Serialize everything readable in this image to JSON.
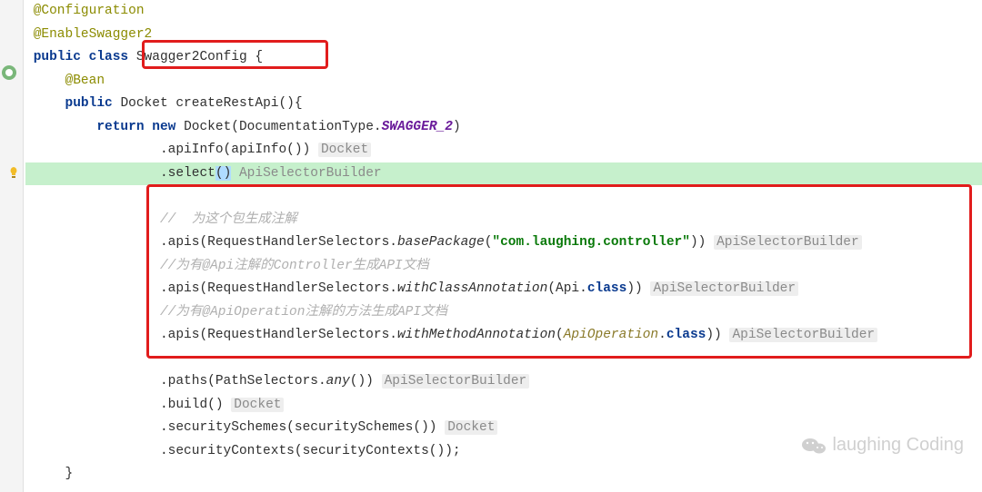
{
  "code": {
    "ann_configuration": "@Configuration",
    "ann_enable_swagger": "@EnableSwagger2",
    "kw_public": "public",
    "kw_class": "class",
    "class_name": " Swagger2Config ",
    "brace_open": "{",
    "brace_close": "}",
    "ann_bean": "@Bean",
    "return_type": "Docket",
    "method_name": "createRestApi",
    "parens": "()",
    "kw_return": "return",
    "kw_new": "new",
    "docket_ctor": "Docket(DocumentationType.",
    "swagger2_const": "SWAGGER_2",
    "close_paren": ")",
    "apiinfo_call": ".apiInfo(apiInfo()) ",
    "select_call": ".select",
    "select_paren_open": "(",
    "select_paren_close": ")",
    "hint_docket": "Docket",
    "hint_asb": "ApiSelectorBuilder",
    "comment_1": "//  为这个包生成注解",
    "apis_prefix": ".apis(RequestHandlerSelectors.",
    "basePackage": "basePackage",
    "pkg_str": "\"com.laughing.controller\"",
    "close2": ")) ",
    "comment_2": "//为有@Api注解的Controller生成API文档",
    "withClassAnnotation": "withClassAnnotation",
    "api_class_open": "(Api.",
    "kw_class_ref": "class",
    "comment_3": "//为有@ApiOperation注解的方法生成API文档",
    "withMethodAnnotation": "withMethodAnnotation",
    "apiop_open": "(",
    "ApiOperation": "ApiOperation",
    "dot_class_close": ".",
    "paths_line": ".paths(PathSelectors.",
    "any_ital": "any",
    "paths_end": "()) ",
    "build_line": ".build() ",
    "secSchemes": ".securitySchemes(securitySchemes()) ",
    "secContexts": ".securityContexts(securityContexts());"
  },
  "watermark": "laughing Coding"
}
